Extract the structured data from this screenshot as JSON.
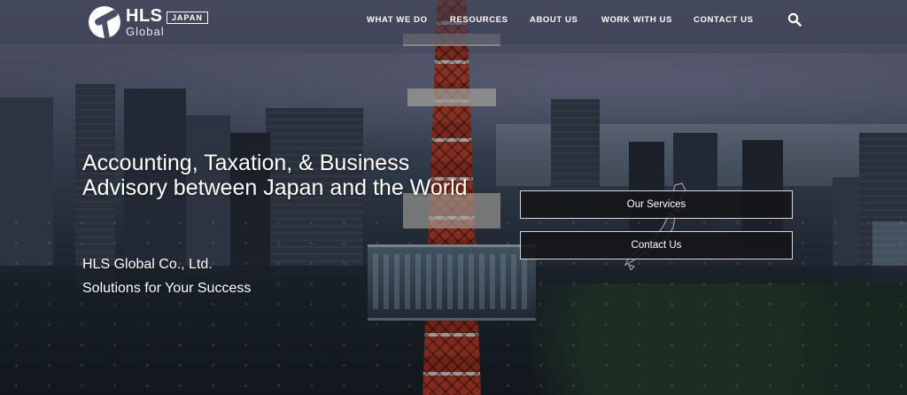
{
  "header": {
    "logo": {
      "brand": "HLS",
      "sub": "Global",
      "badge": "JAPAN"
    },
    "nav": [
      {
        "label": "WHAT WE DO"
      },
      {
        "label": "RESOURCES"
      },
      {
        "label": "ABOUT US"
      },
      {
        "label": "WORK WITH US"
      },
      {
        "label": "CONTACT US"
      }
    ],
    "search_icon": "search-icon"
  },
  "hero": {
    "title": "Accounting, Taxation, & Business Advisory between Japan and the World",
    "company": "HLS Global Co., Ltd.",
    "tagline": "Solutions for Your Success",
    "buttons": {
      "services": "Our Services",
      "contact": "Contact Us"
    }
  },
  "colors": {
    "header_bg": "#3c4054",
    "button_bg": "#141418",
    "button_border": "#d8d8d8",
    "text": "#ffffff"
  }
}
